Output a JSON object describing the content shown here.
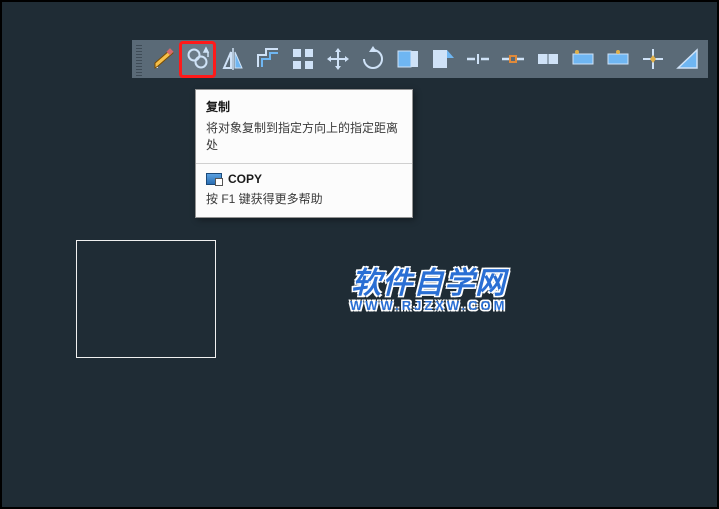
{
  "toolbar": {
    "items": [
      {
        "name": "move-tool",
        "icon": "move-pencil"
      },
      {
        "name": "copy-tool",
        "icon": "copy-circles",
        "selected": true
      },
      {
        "name": "mirror-tool",
        "icon": "mirror"
      },
      {
        "name": "offset-tool",
        "icon": "offset"
      },
      {
        "name": "array-tool",
        "icon": "array"
      },
      {
        "name": "move-tool-2",
        "icon": "move-arrows"
      },
      {
        "name": "rotate-tool",
        "icon": "rotate"
      },
      {
        "name": "trim-tool",
        "icon": "trim"
      },
      {
        "name": "extend-tool",
        "icon": "extend"
      },
      {
        "name": "break-point-tool",
        "icon": "break-point"
      },
      {
        "name": "break-tool",
        "icon": "break"
      },
      {
        "name": "join-tool",
        "icon": "join"
      },
      {
        "name": "chamfer-tool",
        "icon": "chamfer-a"
      },
      {
        "name": "fillet-tool",
        "icon": "fillet-b"
      },
      {
        "name": "explode-tool",
        "icon": "explode"
      },
      {
        "name": "scale-tool",
        "icon": "scale"
      }
    ]
  },
  "tooltip": {
    "title": "复制",
    "desc": "将对象复制到指定方向上的指定距离处",
    "command_label": "COPY",
    "help_text": "按 F1 键获得更多帮助"
  },
  "watermark": {
    "main": "软件自学网",
    "sub": "WWW.RJZXW.COM"
  },
  "colors": {
    "canvas_bg": "#1f2c35",
    "toolbar_bg": "#5a6a77",
    "highlight": "#ff1a1a",
    "icon_light": "#cfe2f7",
    "icon_blue": "#6fb6f2"
  }
}
